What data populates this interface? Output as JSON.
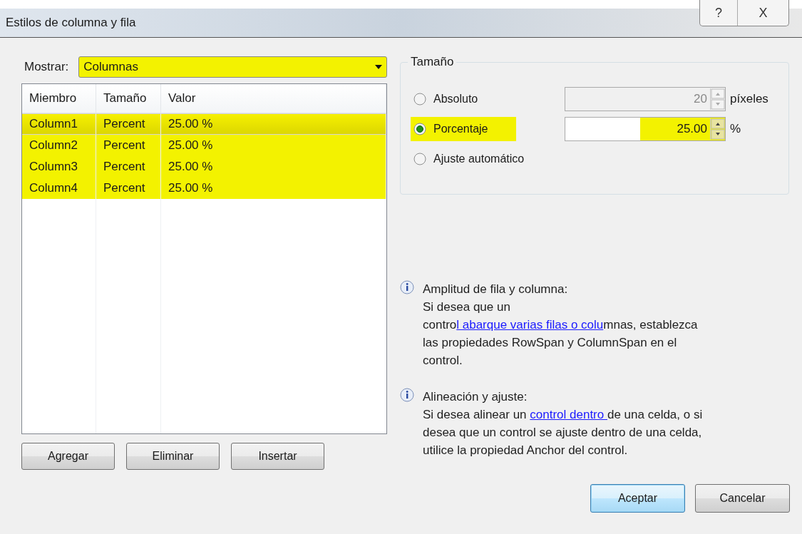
{
  "window": {
    "title": "Estilos de columna y fila",
    "buttons": [
      "?",
      "X"
    ]
  },
  "show": {
    "label": "Mostrar:",
    "value": "Columnas",
    "highlighted": true
  },
  "table": {
    "columns": [
      "Miembro",
      "Tamaño",
      "Valor"
    ],
    "rows": [
      {
        "cells": [
          "Column1",
          "Percent",
          "25.00 %"
        ],
        "selected": true,
        "highlighted": true
      },
      {
        "cells": [
          "Column2",
          "Percent",
          "25.00 %"
        ],
        "selected": false,
        "highlighted": true
      },
      {
        "cells": [
          "Column3",
          "Percent",
          "25.00 %"
        ],
        "selected": false,
        "highlighted": true
      },
      {
        "cells": [
          "Column4",
          "Percent",
          "25.00 %"
        ],
        "selected": false,
        "highlighted": true
      }
    ]
  },
  "list_buttons": [
    "Agregar",
    "Eliminar",
    "Insertar"
  ],
  "size_group": {
    "title": "Tamaño",
    "options": [
      {
        "label": "Absoluto",
        "selected": false,
        "highlighted": false,
        "field": {
          "value": "20",
          "unit": "píxeles",
          "disabled": true,
          "highlighted": false
        }
      },
      {
        "label": "Porcentaje",
        "selected": true,
        "highlighted": true,
        "field": {
          "value": "25.00",
          "unit": "%",
          "disabled": false,
          "highlighted": true
        }
      },
      {
        "label": "Ajuste automático",
        "selected": false,
        "highlighted": false
      }
    ]
  },
  "info": [
    {
      "heading": "Amplitud de fila y columna:",
      "parts": [
        {
          "text": "Si desea que un contro",
          "link": false
        },
        {
          "text": "l abarque varias filas o colu",
          "link": true
        },
        {
          "text": "mnas, establezca las propiedades RowSpan y ColumnSpan en el control.",
          "link": false
        }
      ]
    },
    {
      "heading": "Alineación y ajuste:",
      "parts": [
        {
          "text": "Si desea alinear un ",
          "link": false
        },
        {
          "text": "control dentro ",
          "link": true
        },
        {
          "text": "de una celda, o si desea que un control se ajuste dentro de una celda, utilice la propiedad Anchor del control.",
          "link": false
        }
      ]
    }
  ],
  "dialog_buttons": [
    {
      "label": "Aceptar",
      "default": true
    },
    {
      "label": "Cancelar",
      "default": false
    }
  ]
}
